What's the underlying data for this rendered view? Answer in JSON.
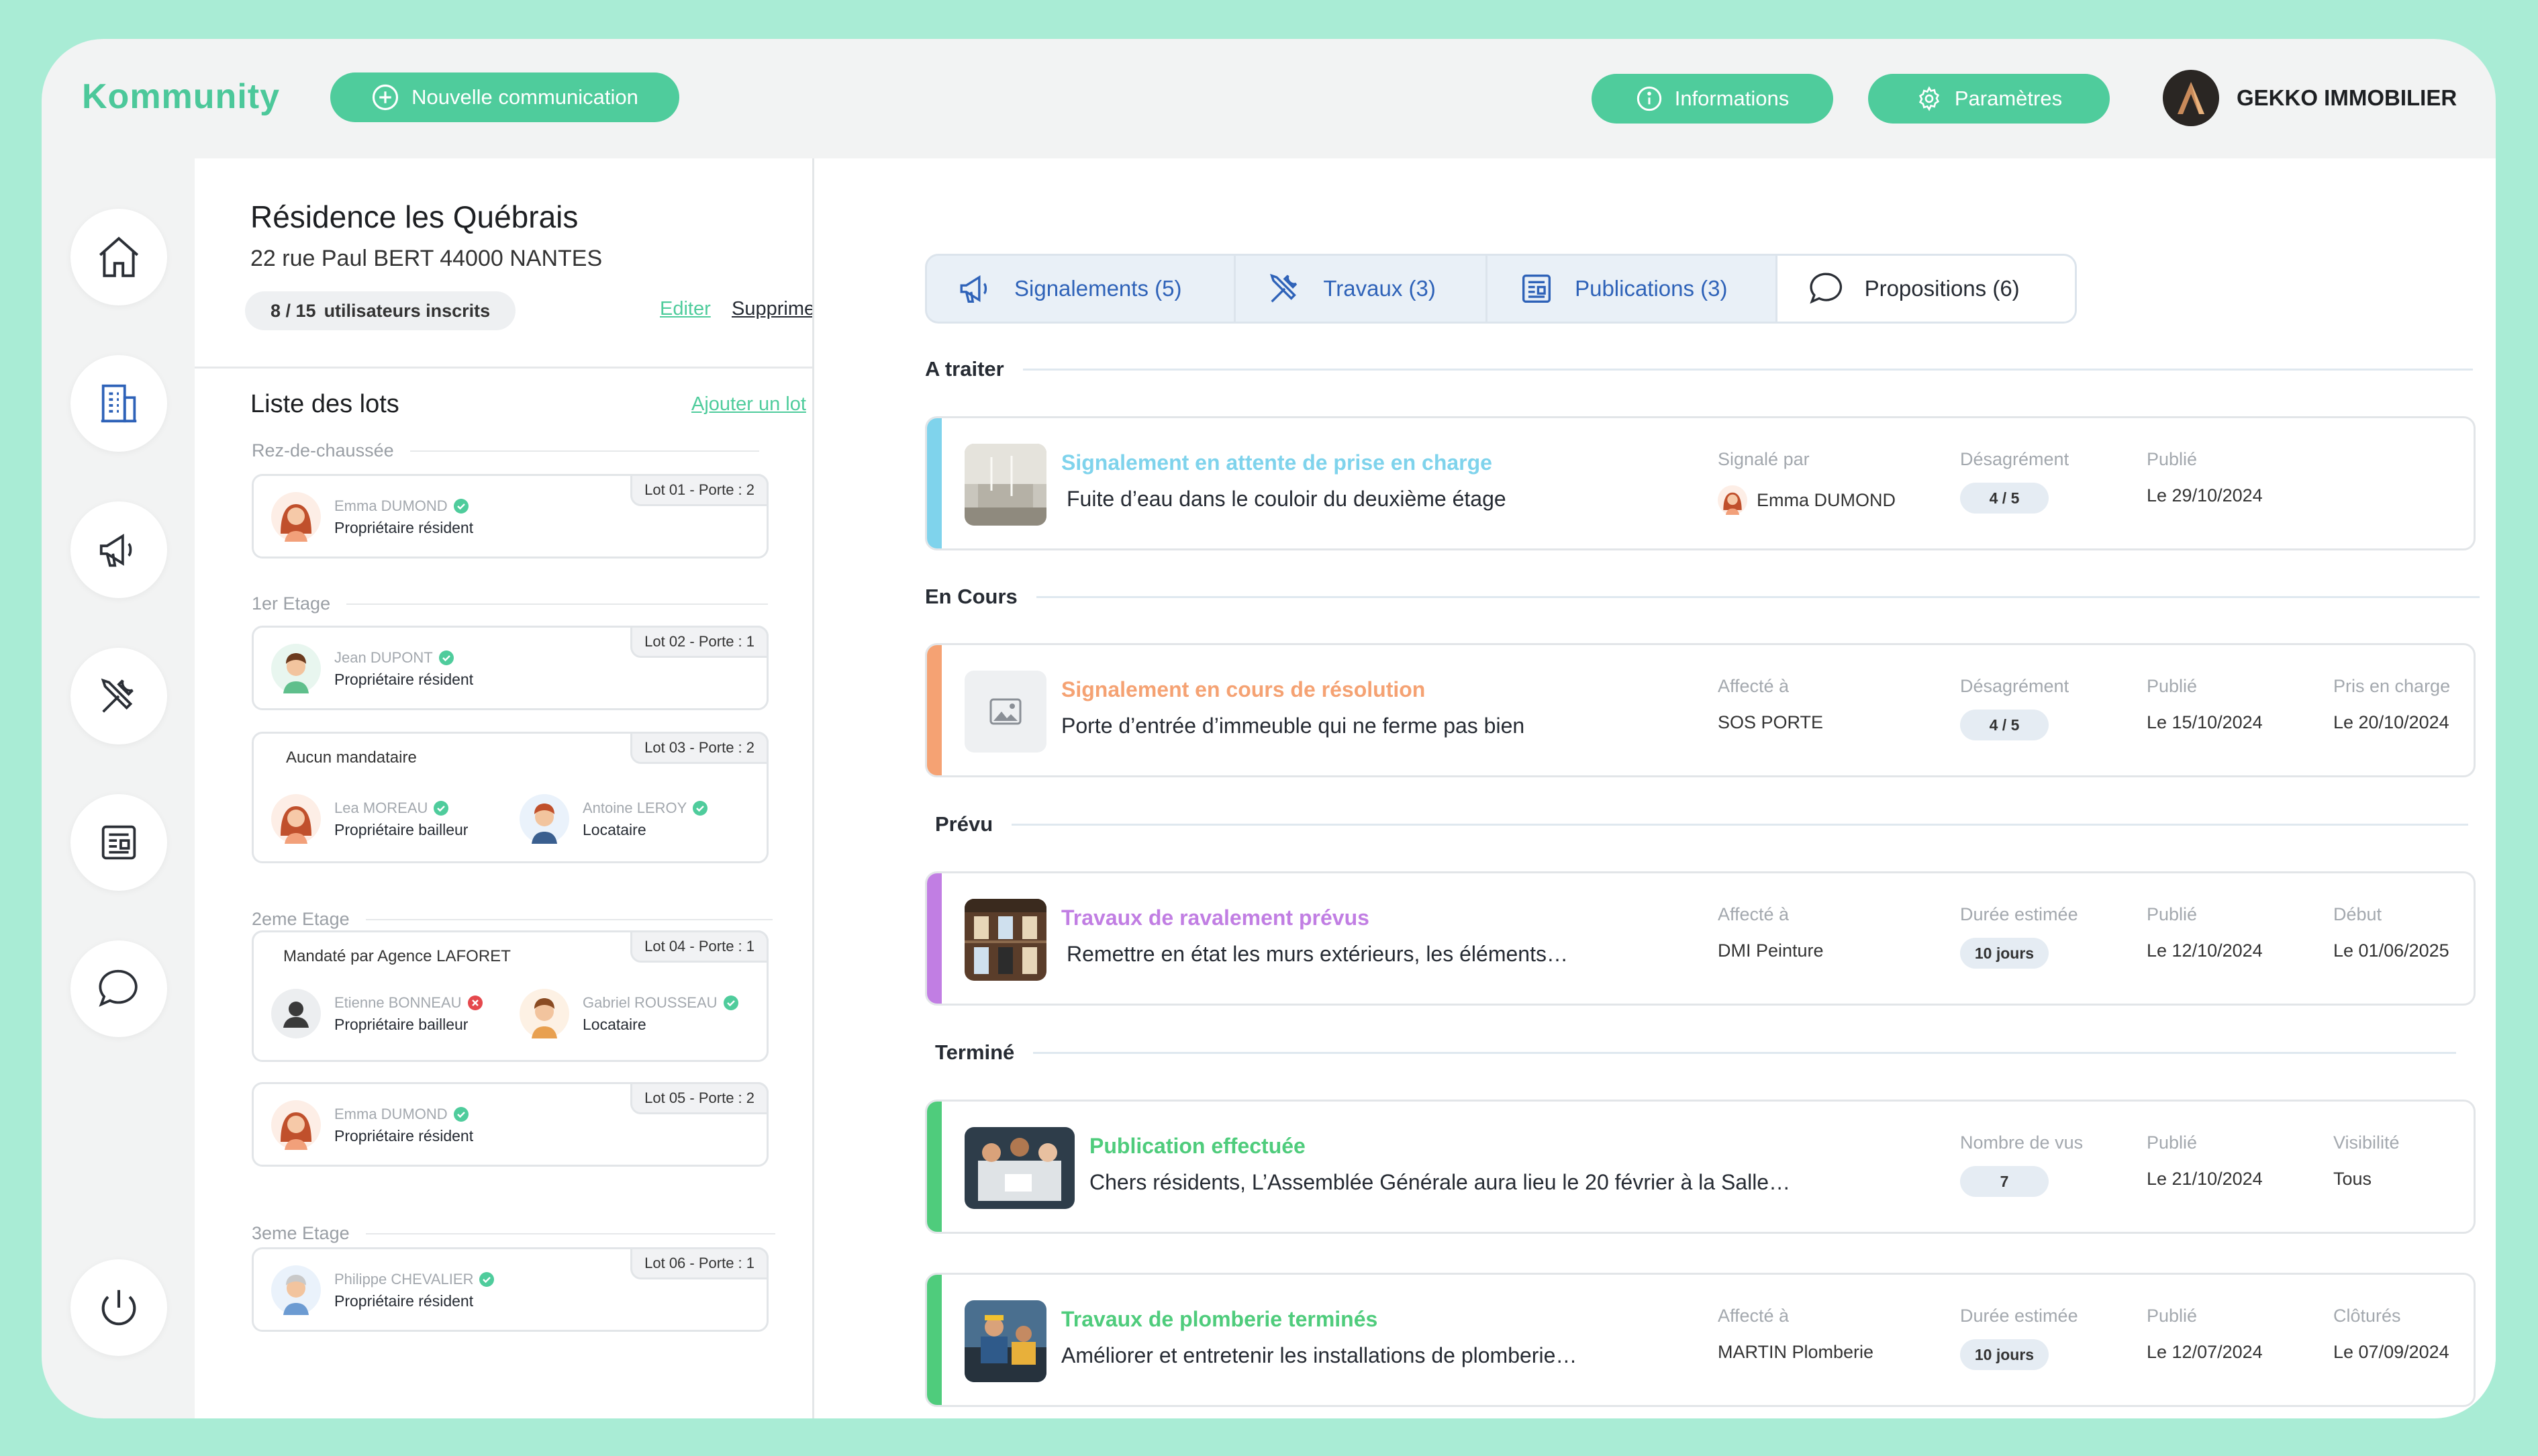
{
  "app": {
    "logo": "Kommunity"
  },
  "header": {
    "new_comm_label": "Nouvelle communication",
    "info_label": "Informations",
    "settings_label": "Paramètres",
    "company_name": "GEKKO IMMOBILIER"
  },
  "residence": {
    "name": "Résidence les Québrais",
    "address": "22 rue Paul BERT 44000 NANTES",
    "users_count": "8 / 15",
    "users_label": "utilisateurs inscrits",
    "edit_label": "Editer",
    "delete_label": "Supprimer"
  },
  "lots": {
    "title": "Liste des lots",
    "add_label": "Ajouter un lot",
    "floors": [
      "Rez-de-chaussée",
      "1er Etage",
      "2eme Etage",
      "3eme Etage"
    ],
    "items": [
      {
        "tag": "Lot 01 - Porte : 2",
        "people": [
          {
            "name": "Emma DUMOND",
            "role": "Propriétaire résident"
          }
        ]
      },
      {
        "tag": "Lot 02 - Porte : 1",
        "people": [
          {
            "name": "Jean DUPONT",
            "role": "Propriétaire résident"
          }
        ]
      },
      {
        "tag": "Lot 03 - Porte : 2",
        "mandate": "Aucun mandataire",
        "people": [
          {
            "name": "Lea MOREAU",
            "role": "Propriétaire bailleur"
          },
          {
            "name": "Antoine LEROY",
            "role": "Locataire"
          }
        ]
      },
      {
        "tag": "Lot 04 - Porte : 1",
        "mandate": "Mandaté par Agence LAFORET",
        "people": [
          {
            "name": "Etienne BONNEAU",
            "role": "Propriétaire bailleur"
          },
          {
            "name": "Gabriel ROUSSEAU",
            "role": "Locataire"
          }
        ]
      },
      {
        "tag": "Lot 05 - Porte : 2",
        "people": [
          {
            "name": "Emma DUMOND",
            "role": "Propriétaire résident"
          }
        ]
      },
      {
        "tag": "Lot 06 - Porte : 1",
        "people": [
          {
            "name": "Philippe CHEVALIER",
            "role": "Propriétaire résident"
          }
        ]
      }
    ]
  },
  "tabs": [
    {
      "label": "Signalements (5)",
      "icon": "megaphone-icon"
    },
    {
      "label": "Travaux (3)",
      "icon": "tools-icon"
    },
    {
      "label": "Publications (3)",
      "icon": "newspaper-icon"
    },
    {
      "label": "Propositions (6)",
      "icon": "chat-bubble-icon"
    }
  ],
  "sections": [
    "A traiter",
    "En Cours",
    "Prévu",
    "Terminé"
  ],
  "cards": [
    {
      "title": "Signalement en attente de prise en charge",
      "desc": "Fuite d’eau dans le couloir du deuxième étage",
      "accent": "#7fd3ec",
      "m1_label": "Signalé par",
      "m1_value": "Emma DUMOND",
      "m2_label": "Désagrément",
      "m2_value": "4 / 5",
      "m3_label": "Publié",
      "m3_value": "Le 29/10/2024"
    },
    {
      "title": "Signalement en cours de résolution",
      "desc": "Porte d’entrée d’immeuble qui ne ferme pas bien",
      "accent": "#f5a273",
      "m1_label": "Affecté à",
      "m1_value": "SOS PORTE",
      "m2_label": "Désagrément",
      "m2_value": "4 / 5",
      "m3_label": "Publié",
      "m3_value": "Le 15/10/2024",
      "m4_label": "Pris en charge",
      "m4_value": "Le 20/10/2024"
    },
    {
      "title": "Travaux de ravalement prévus",
      "desc": "Remettre en état les murs extérieurs, les éléments…",
      "accent": "#c17ee3",
      "m1_label": "Affecté à",
      "m1_value": "DMI Peinture",
      "m2_label": "Durée estimée",
      "m2_value": "10 jours",
      "m3_label": "Publié",
      "m3_value": "Le 12/10/2024",
      "m4_label": "Début",
      "m4_value": "Le 01/06/2025"
    },
    {
      "title": "Publication effectuée",
      "desc": "Chers résidents, L’Assemblée Générale aura lieu le 20 février à la Salle…",
      "accent": "#4fcc7c",
      "m2_label": "Nombre de vus",
      "m2_value": "7",
      "m3_label": "Publié",
      "m3_value": "Le 21/10/2024",
      "m4_label": "Visibilité",
      "m4_value": "Tous"
    },
    {
      "title": "Travaux de plomberie terminés",
      "desc": "Améliorer et entretenir les installations de plomberie…",
      "accent": "#4fcc7c",
      "m1_label": "Affecté à",
      "m1_value": "MARTIN Plomberie",
      "m2_label": "Durée estimée",
      "m2_value": "10 jours",
      "m3_label": "Publié",
      "m3_value": "Le 12/07/2024",
      "m4_label": "Clôturés",
      "m4_value": "Le 07/09/2024"
    }
  ],
  "colors": {
    "brand_green": "#4fcc9c",
    "tab_blue": "#2e62b8",
    "verified": "#4fcc9c",
    "unverified": "#e5484d"
  }
}
